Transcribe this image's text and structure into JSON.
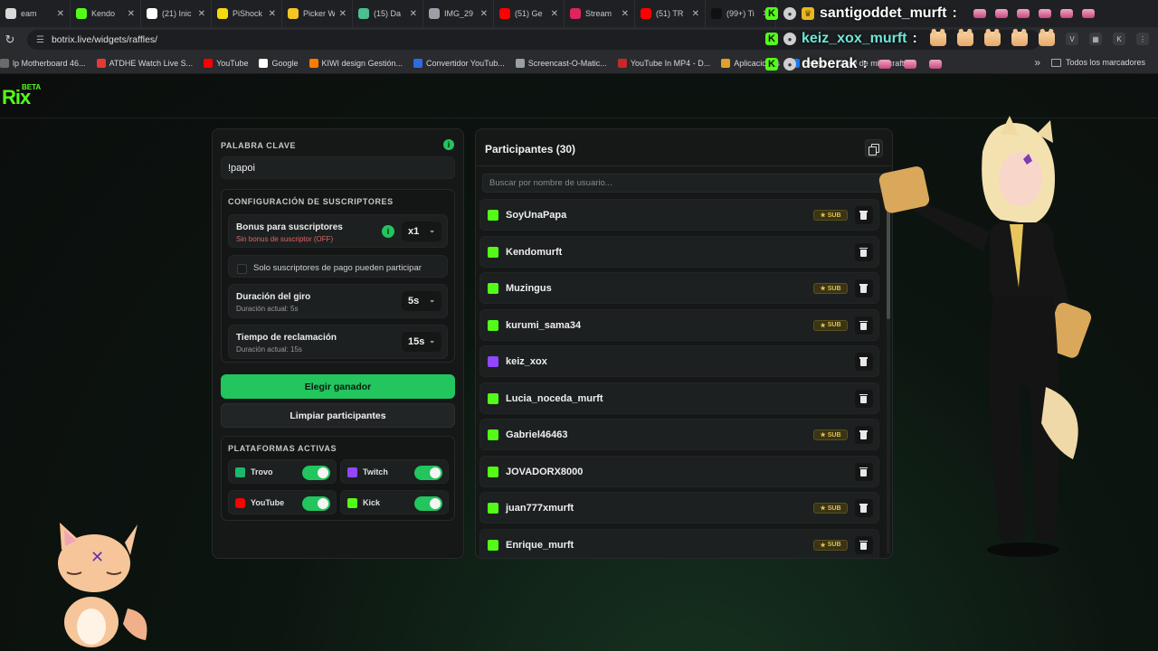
{
  "browser": {
    "tabs": [
      {
        "label": "eam",
        "color": "#d9d9d9"
      },
      {
        "label": "Kendo",
        "color": "#53fc18"
      },
      {
        "label": "(21) Inic",
        "color": "#ffffff"
      },
      {
        "label": "PiShock",
        "color": "#f5d90a"
      },
      {
        "label": "Picker W",
        "color": "#f3c623"
      },
      {
        "label": "(15) Da",
        "color": "#4bbf8f"
      },
      {
        "label": "IMG_29",
        "color": "#9aa0a6"
      },
      {
        "label": "(51) Ge",
        "color": "#ff0000"
      },
      {
        "label": "Stream",
        "color": "#e0245e"
      },
      {
        "label": "(51) TR",
        "color": "#ff0000"
      },
      {
        "label": "(99+) Ti",
        "color": "#111111"
      }
    ],
    "url": "botrix.live/widgets/raffles/",
    "bookmarks": [
      {
        "label": "lp Motherboard 46...",
        "color": "#6b6b6b"
      },
      {
        "label": "ATDHE Watch Live S...",
        "color": "#e53935"
      },
      {
        "label": "YouTube",
        "color": "#ff0000"
      },
      {
        "label": "Google",
        "color": "#ffffff"
      },
      {
        "label": "KIWI design Gestión...",
        "color": "#ff7a00"
      },
      {
        "label": "Convertidor YouTub...",
        "color": "#2d6cdf"
      },
      {
        "label": "Screencast-O-Matic...",
        "color": "#9aa0a6"
      },
      {
        "label": "YouTube In MP4 - D...",
        "color": "#c62828"
      },
      {
        "label": "Aplicaciones",
        "color": "#e0a02a"
      },
      {
        "label": "Faceb",
        "color": "#1877f2"
      }
    ],
    "bookmark_extra": "(2) sv de minecraft...",
    "all_bookmarks": "Todos los marcadores"
  },
  "chat": [
    {
      "user": "santigoddet_murft",
      "suffix": ":",
      "color": "#ffffff"
    },
    {
      "user": "keiz_xox_murft",
      "suffix": ":",
      "color": "#6ee7d8"
    },
    {
      "user": "deberak",
      "suffix": ":",
      "color": "#ffffff"
    }
  ],
  "app": {
    "logo": "Rix",
    "beta": "BETA"
  },
  "settings": {
    "keyword_title": "PALABRA CLAVE",
    "keyword_value": "!papoi",
    "subs_title": "CONFIGURACIÓN DE SUSCRIPTORES",
    "bonus_title": "Bonus para suscriptores",
    "bonus_sub": "Sin bonus de suscriptor (OFF)",
    "bonus_value": "x1",
    "paid_only_label": "Solo suscriptores de pago pueden participar",
    "spin_title": "Duración del giro",
    "spin_sub": "Duración actual: 5s",
    "spin_value": "5s",
    "claim_title": "Tiempo de reclamación",
    "claim_sub": "Duración actual: 15s",
    "claim_value": "15s",
    "pick_winner": "Elegir ganador",
    "clear_participants": "Limpiar participantes",
    "platforms_title": "PLATAFORMAS ACTIVAS",
    "platforms": [
      {
        "name": "Trovo",
        "color": "#1bb76e",
        "enabled": true
      },
      {
        "name": "Twitch",
        "color": "#9146ff",
        "enabled": true
      },
      {
        "name": "YouTube",
        "color": "#ff0000",
        "enabled": true
      },
      {
        "name": "Kick",
        "color": "#53fc18",
        "enabled": true
      }
    ]
  },
  "participants": {
    "title": "Participantes (30)",
    "search_placeholder": "Buscar por nombre de usuario...",
    "sub_label": "SUB",
    "list": [
      {
        "name": "SoyUnaPapa",
        "platform": "kick",
        "sub": true
      },
      {
        "name": "Kendomurft",
        "platform": "kick",
        "sub": false
      },
      {
        "name": "Muzingus",
        "platform": "kick",
        "sub": true
      },
      {
        "name": "kurumi_sama34",
        "platform": "kick",
        "sub": true
      },
      {
        "name": "keiz_xox",
        "platform": "twitch",
        "sub": false
      },
      {
        "name": "Lucia_noceda_murft",
        "platform": "kick",
        "sub": false
      },
      {
        "name": "Gabriel46463",
        "platform": "kick",
        "sub": true
      },
      {
        "name": "JOVADORX8000",
        "platform": "kick",
        "sub": false
      },
      {
        "name": "juan777xmurft",
        "platform": "kick",
        "sub": true
      },
      {
        "name": "Enrique_murft",
        "platform": "kick",
        "sub": true
      }
    ]
  },
  "colors": {
    "accent": "#22c55e",
    "kick": "#53fc18",
    "twitch": "#9146ff"
  }
}
